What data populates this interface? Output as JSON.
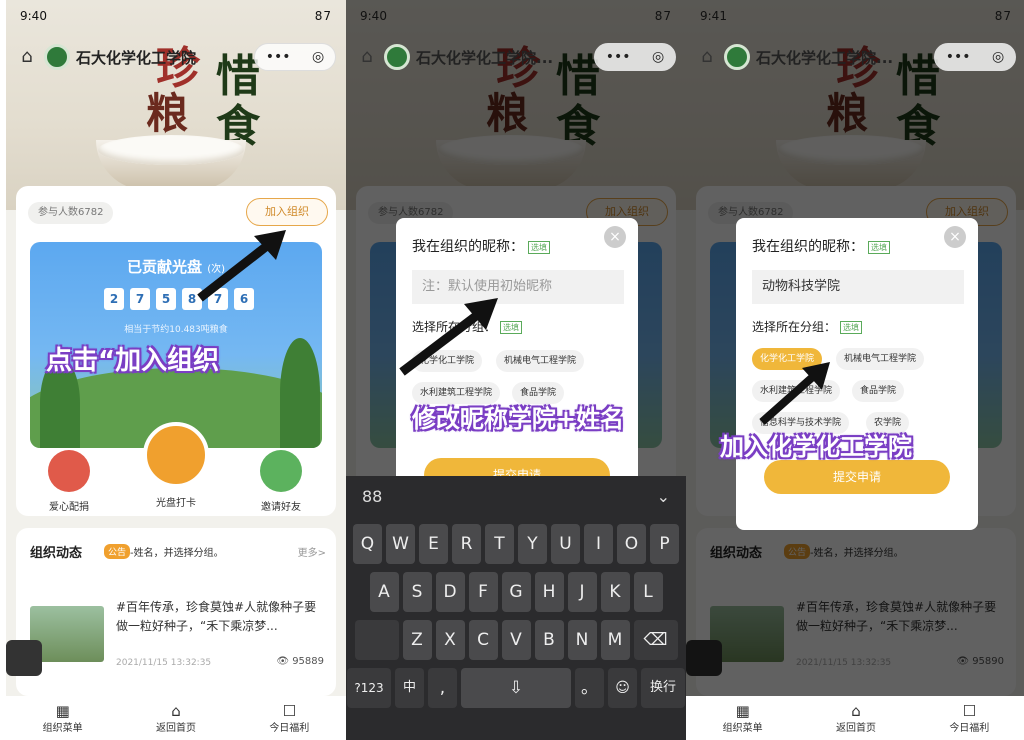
{
  "status": {
    "time1": "9:40",
    "time2": "9:40",
    "time3": "9:41",
    "right": "87"
  },
  "nav": {
    "title_short": "石大化学化工学院",
    "title_full": "石大化学化工学院...",
    "more": "•••",
    "target": "◎"
  },
  "hero": {
    "c1": "珍",
    "c2": "惜",
    "c3": "粮",
    "c4": "食"
  },
  "org": {
    "participants": "参与人数6782",
    "join": "加入组织",
    "contributed": "已贡献光盘",
    "unit": "(次)",
    "digits": [
      "2",
      "7",
      "5",
      "8",
      "7",
      "6"
    ],
    "equivalent": "相当于节约10.483吨粮食"
  },
  "actions": {
    "a1": "爱心配捐",
    "a2": "光盘打卡",
    "a3": "邀请好友"
  },
  "news": {
    "header": "组织动态",
    "tag": "公告",
    "snippet": "-姓名，并选择分组。",
    "more": "更多>",
    "body": "#百年传承，珍食莫蚀#人就像种子要做一粒好种子，“禾下乘凉梦...",
    "date": "2021/11/15 13:32:35",
    "views": "95889",
    "views3": "95890"
  },
  "tabs": {
    "t1": "组织菜单",
    "t2": "返回首页",
    "t3": "今日福利"
  },
  "dialog": {
    "title": "我在组织的昵称：",
    "required": "选填",
    "placeholder": "注：默认使用初始昵称",
    "filled": "动物科技学院",
    "group_label": "选择所在分组：",
    "groups": [
      "化学化工学院",
      "机械电气工程学院",
      "水利建筑工程学院",
      "食品学院",
      "信息科学与技术学院",
      "农学院"
    ],
    "submit": "提交申请",
    "close": "×"
  },
  "keyboard": {
    "row1": [
      "Q",
      "W",
      "E",
      "R",
      "T",
      "Y",
      "U",
      "I",
      "O",
      "P"
    ],
    "row2": [
      "A",
      "S",
      "D",
      "F",
      "G",
      "H",
      "J",
      "K",
      "L"
    ],
    "row3": [
      "Z",
      "X",
      "C",
      "V",
      "B",
      "N",
      "M"
    ],
    "num": "?123",
    "lang": "中",
    "comma": ",",
    "period": "。",
    "enter": "换行",
    "grid": "88",
    "collapse": "⌄",
    "del": "⌫",
    "mic": "⇩"
  },
  "annotations": {
    "a1": "点击“加入组织",
    "a2": "修改昵称学院+姓名",
    "a3": "加入化学化工学院"
  }
}
